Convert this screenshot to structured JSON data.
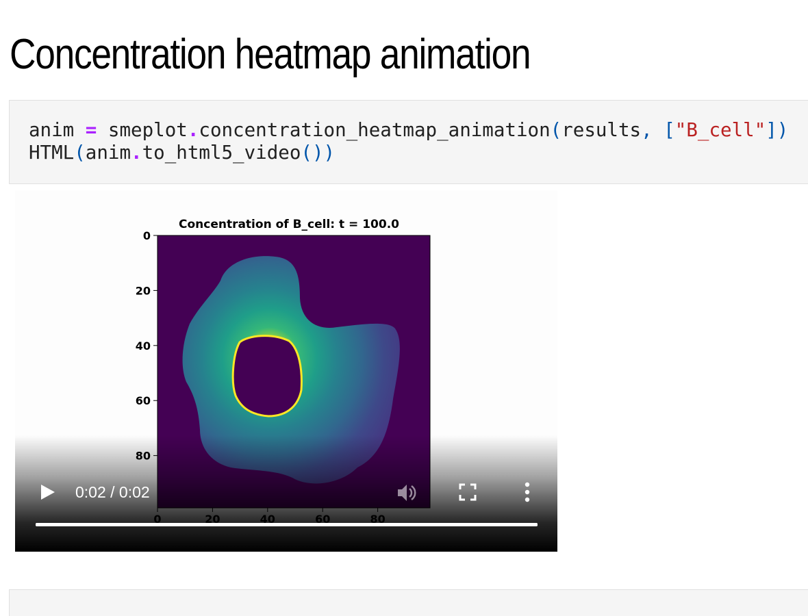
{
  "page": {
    "heading": "Concentration heatmap animation"
  },
  "code_cell": {
    "line1": {
      "var": "anim",
      "op": "=",
      "call": "smeplot",
      "dot": ".",
      "method": "concentration_heatmap_animation",
      "open_paren": "(",
      "arg": "results",
      "comma": ",",
      "open_bracket": "[",
      "string": "\"B_cell\"",
      "close": "])"
    },
    "line2": {
      "func": "HTML",
      "open_paren": "(",
      "obj": "anim",
      "dot": ".",
      "method": "to_html5_video",
      "close": "())"
    }
  },
  "video": {
    "frame_title": "Concentration of B_cell: t = 100.0",
    "y_ticks": [
      "0",
      "20",
      "40",
      "60",
      "80"
    ],
    "x_ticks": [
      "0",
      "20",
      "40",
      "60",
      "80"
    ],
    "colormap": "viridis",
    "time_display": "0:02 / 0:02",
    "progress": 1.0,
    "controls": {
      "play_icon": "play-icon",
      "volume_icon": "volume-icon",
      "fullscreen_icon": "fullscreen-icon",
      "more_icon": "more-vertical-icon"
    }
  }
}
